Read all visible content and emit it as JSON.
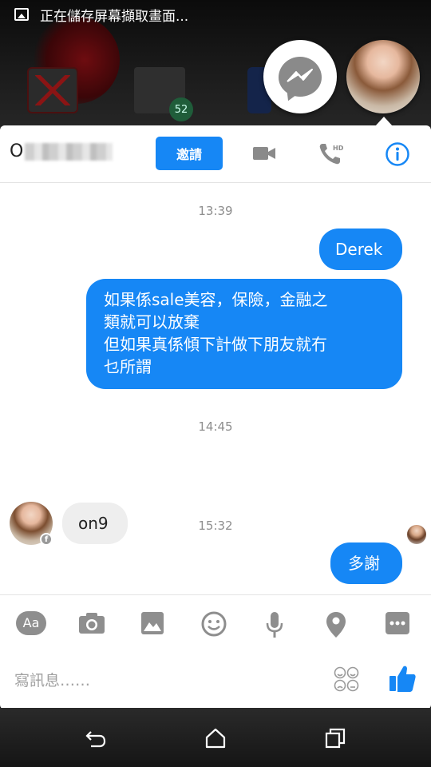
{
  "status_bar": {
    "notification_text": "正在儲存屏幕擷取畫面..."
  },
  "home_screen": {
    "messages_badge": "52"
  },
  "header": {
    "contact_name_visible": "O",
    "invite_label": "邀請",
    "icons": [
      "video-camera-icon",
      "hd-call-icon",
      "info-icon"
    ]
  },
  "messages": {
    "time_1": "13:39",
    "out_1": "Derek",
    "out_2_lines": [
      "如果係sale美容，保險，金融之",
      "類就可以放棄",
      "但如果真係傾下計做下朋友就冇",
      "乜所謂"
    ],
    "time_2": "14:45",
    "in_1": "on9",
    "time_3": "15:32",
    "out_3": "多謝"
  },
  "toolbar": {
    "aa_label": "Aa",
    "icons": [
      "camera-icon",
      "gallery-icon",
      "emoji-icon",
      "microphone-icon",
      "location-icon",
      "more-icon"
    ]
  },
  "compose": {
    "placeholder": "寫訊息……"
  },
  "colors": {
    "accent": "#1687f5",
    "incoming": "#eeeeee"
  }
}
